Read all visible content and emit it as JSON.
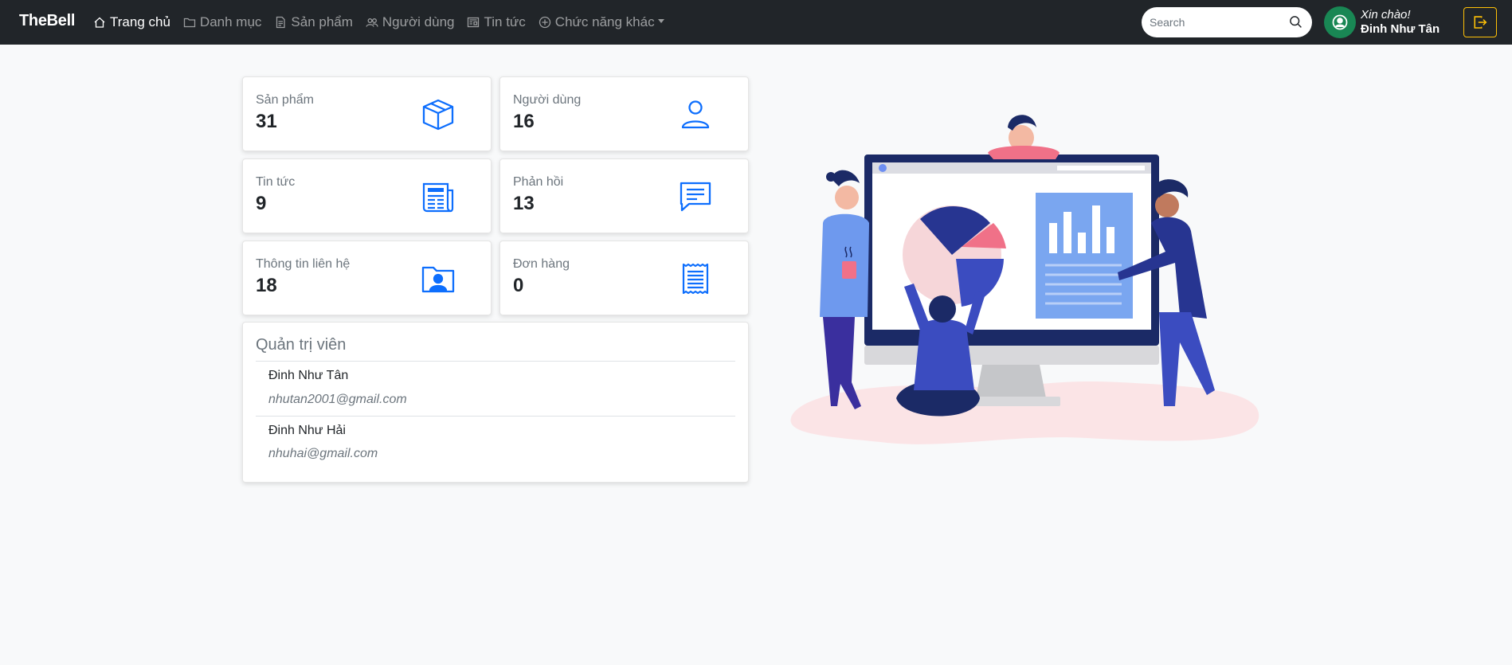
{
  "navbar": {
    "brand": "TheBell",
    "items": [
      {
        "label": "Trang chủ",
        "icon": "house-icon"
      },
      {
        "label": "Danh mục",
        "icon": "folder-icon"
      },
      {
        "label": "Sản phẩm",
        "icon": "file-icon"
      },
      {
        "label": "Người dùng",
        "icon": "people-icon"
      },
      {
        "label": "Tin tức",
        "icon": "newspaper-icon"
      },
      {
        "label": "Chức năng khác",
        "icon": "plus-circle-icon"
      }
    ],
    "search_placeholder": "Search",
    "greeting": "Xin chào!",
    "username": "Đinh Như Tân"
  },
  "stats": [
    {
      "label": "Sản phẩm",
      "value": "31",
      "icon": "box-icon"
    },
    {
      "label": "Người dùng",
      "value": "16",
      "icon": "person-icon"
    },
    {
      "label": "Tin tức",
      "value": "9",
      "icon": "newspaper-icon"
    },
    {
      "label": "Phản hồi",
      "value": "13",
      "icon": "chat-icon"
    },
    {
      "label": "Thông tin liên hệ",
      "value": "18",
      "icon": "contact-folder-icon"
    },
    {
      "label": "Đơn hàng",
      "value": "0",
      "icon": "receipt-icon"
    }
  ],
  "admins": {
    "title": "Quản trị viên",
    "list": [
      {
        "name": "Đinh Như Tân",
        "email": "nhutan2001@gmail.com"
      },
      {
        "name": "Đinh Như Hải",
        "email": "nhuhai@gmail.com"
      }
    ]
  },
  "colors": {
    "navbar": "#212529",
    "accent": "#0d6efd",
    "avatar": "#198754",
    "logout": "#ffc107"
  }
}
